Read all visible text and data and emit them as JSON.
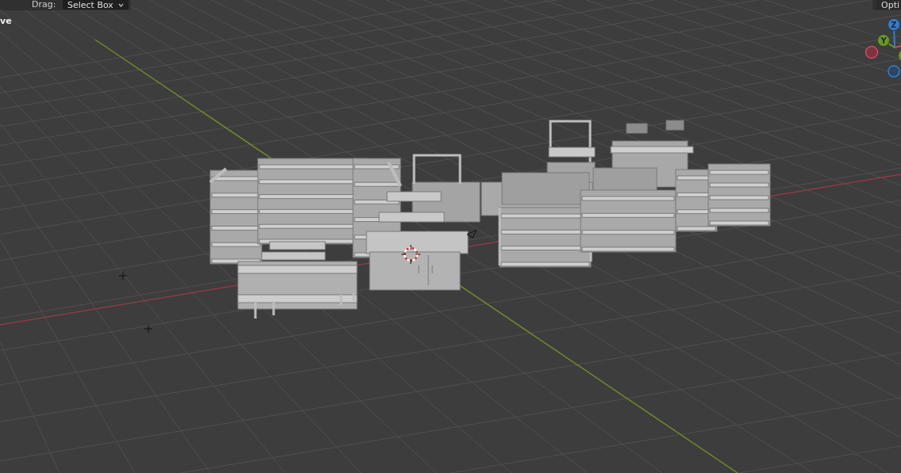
{
  "header": {
    "mode_label": "ve",
    "drag_label": "Drag:",
    "drag_select": "Select Box",
    "options_button": "Opti"
  },
  "gizmo": {
    "axes": [
      {
        "label": "Z",
        "color": "#2f80d8"
      },
      {
        "label": "Y",
        "color": "#6b9a1e"
      }
    ]
  }
}
